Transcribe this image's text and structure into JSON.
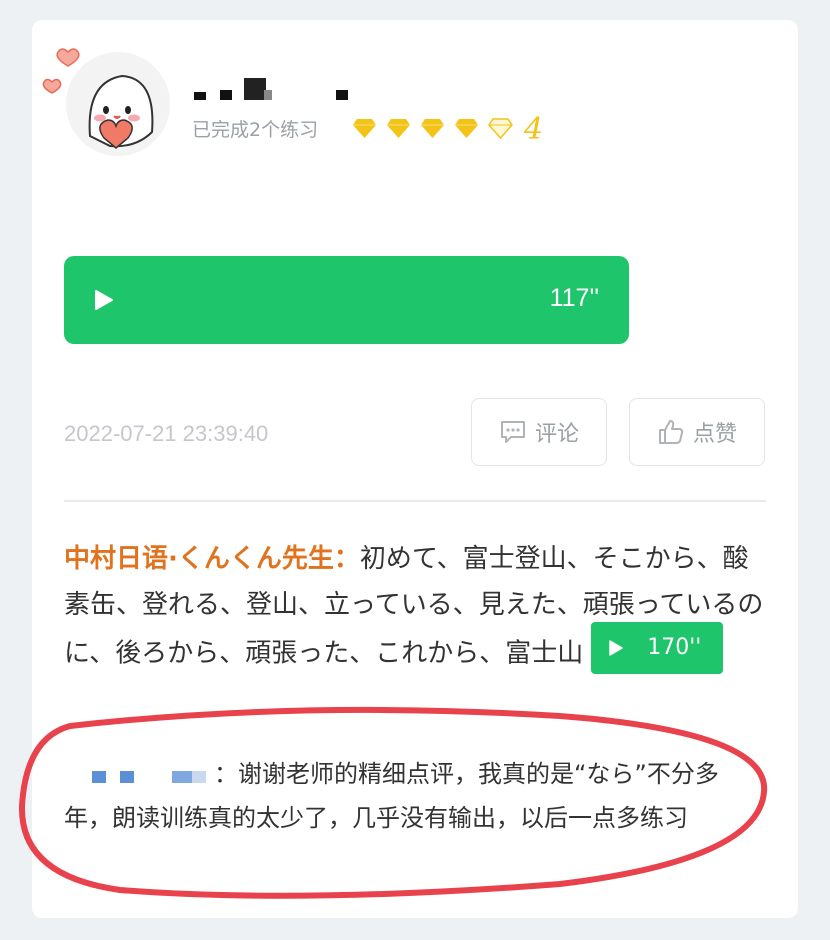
{
  "post": {
    "practice_text": "已完成2个练习",
    "gem_count": "4",
    "gems": {
      "filled": 4,
      "total": 5,
      "color": "#f3c316"
    },
    "audio_duration": "117''",
    "timestamp": "2022-07-21 23:39:40",
    "comment_label": "评论",
    "like_label": "点赞"
  },
  "teacher_comment": {
    "name": "中村日语·くんくん先生：",
    "text": "初めて、富士登山、そこから、酸素缶、登れる、登山、立っている、見えた、頑張っているのに、後ろから、頑張った、これから、富士山",
    "audio_duration": "170''"
  },
  "reply": {
    "text": "：谢谢老师的精细点评，我真的是“なら”不分多年，朗读训练真的太少了，几乎没有输出，以后一点多练习"
  },
  "colors": {
    "accent_green": "#1ec56b",
    "teacher_orange": "#e1731f",
    "annotation_red": "#e8434c"
  }
}
